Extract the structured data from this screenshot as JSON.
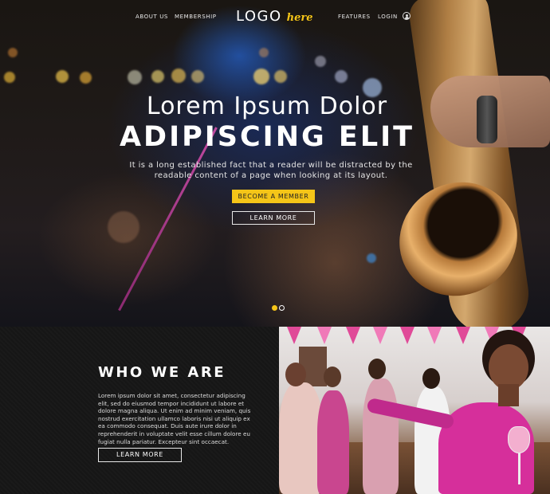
{
  "nav": {
    "left_links": [
      "ABOUT US",
      "MEMBERSHIP"
    ],
    "logo_main": "LOGO",
    "logo_accent": "here",
    "right_links": [
      "FEATURES",
      "LOGIN"
    ],
    "user_icon": "user-circle-icon"
  },
  "hero": {
    "title_line1": "Lorem Ipsum Dolor",
    "title_line2": "ADIPISCING ELIT",
    "description": "It is a long established fact that a reader will be distracted by the readable content of a page when looking at its layout.",
    "primary_button": "BECOME A MEMBER",
    "secondary_button": "LEARN MORE",
    "slides_total": 2,
    "active_slide": 1
  },
  "about": {
    "title": "WHO WE ARE",
    "text": "Lorem ipsum dolor sit amet, consectetur adipiscing elit, sed do eiusmod tempor incididunt ut labore et dolore magna aliqua. Ut enim ad minim veniam, quis nostrud exercitation ullamco laboris nisi ut aliquip ex ea commodo consequat. Duis aute irure dolor in reprehenderit in voluptate velit esse cillum dolore eu fugiat nulla pariatur. Excepteur sint occaecat.",
    "button": "LEARN MORE"
  },
  "colors": {
    "accent": "#f5c518",
    "dark_bg": "#161616",
    "bunting": "#e04a98"
  }
}
